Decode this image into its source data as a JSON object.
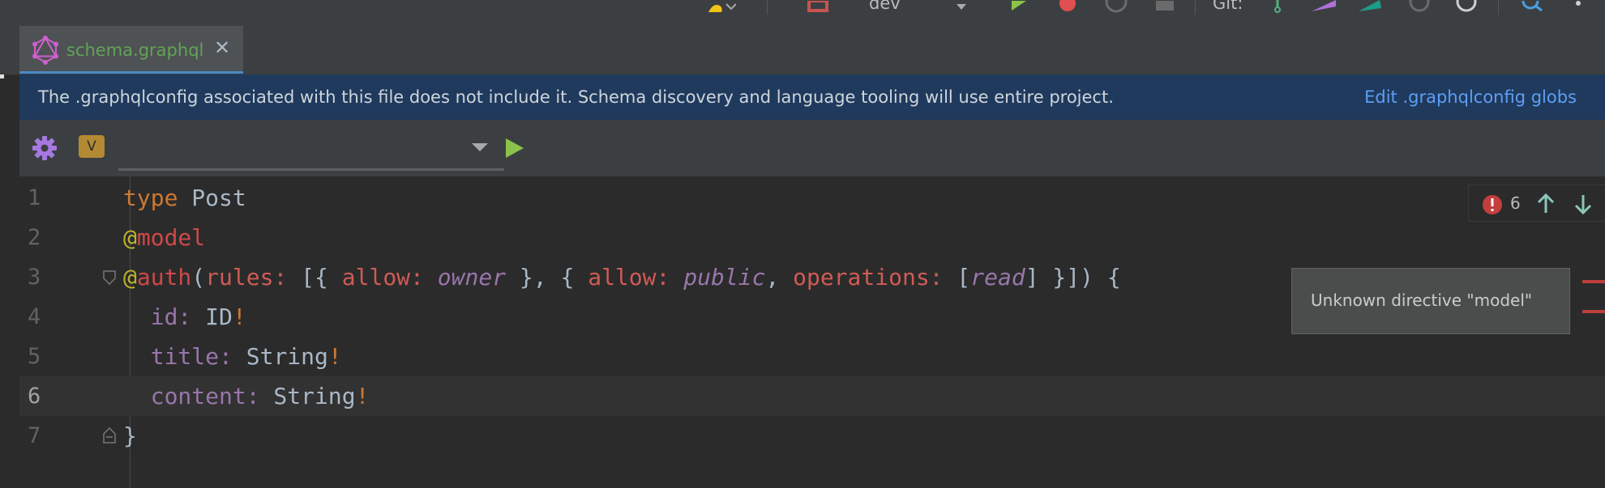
{
  "toolbar": {
    "run_config": "dev",
    "git_label": "Git:"
  },
  "tab": {
    "title": "schema.graphql",
    "close_glyph": "✕",
    "icon": "graphql-icon"
  },
  "banner": {
    "message": "The .graphqlconfig associated with this file does not include it. Schema discovery and language tooling will use entire project.",
    "link": "Edit .graphqlconfig globs"
  },
  "graphql_toolbar": {
    "variables_badge": "V",
    "endpoint_value": ""
  },
  "editor": {
    "line_numbers": [
      "1",
      "2",
      "3",
      "4",
      "5",
      "6",
      "7"
    ],
    "current_line": "6",
    "error_count": "6",
    "tooltip": "Unknown directive \"model\""
  },
  "colors": {
    "accent_blue": "#4a88c7",
    "banner_bg": "#1f3a5d",
    "link": "#5e9ef5",
    "keyword": "#cc7832",
    "error": "#bc3f3c",
    "run_green": "#8bc34a"
  }
}
